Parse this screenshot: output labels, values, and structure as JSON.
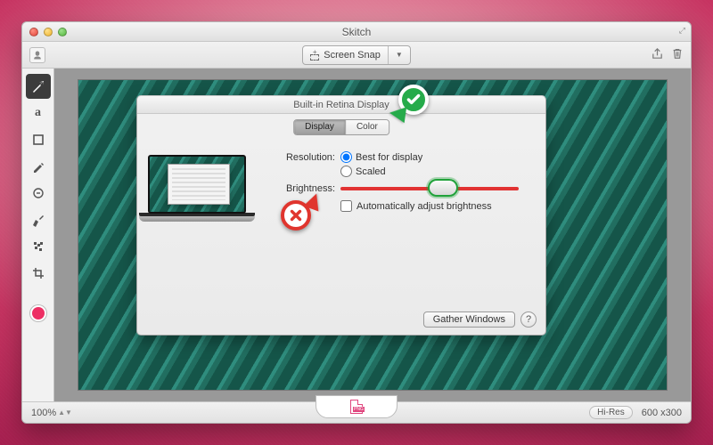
{
  "window": {
    "title": "Skitch"
  },
  "toolbar": {
    "screen_snap_label": "Screen Snap"
  },
  "tools": {
    "order": [
      "arrow",
      "text",
      "shape",
      "pen",
      "highlighter",
      "stamp",
      "pixelate",
      "crop"
    ],
    "active": "arrow",
    "color": "#ed2f64"
  },
  "panel": {
    "title": "Built-in Retina Display",
    "tabs": {
      "display": "Display",
      "color": "Color",
      "active": "display"
    },
    "labels": {
      "resolution": "Resolution:",
      "brightness": "Brightness:"
    },
    "resolution": {
      "best": "Best for display",
      "scaled": "Scaled",
      "selected": "best"
    },
    "auto_brightness_label": "Automatically adjust brightness",
    "auto_brightness_checked": false,
    "gather_windows_label": "Gather Windows",
    "help_label": "?"
  },
  "status": {
    "zoom": "100%",
    "hires": "Hi-Res",
    "dimensions": "600 x300"
  }
}
